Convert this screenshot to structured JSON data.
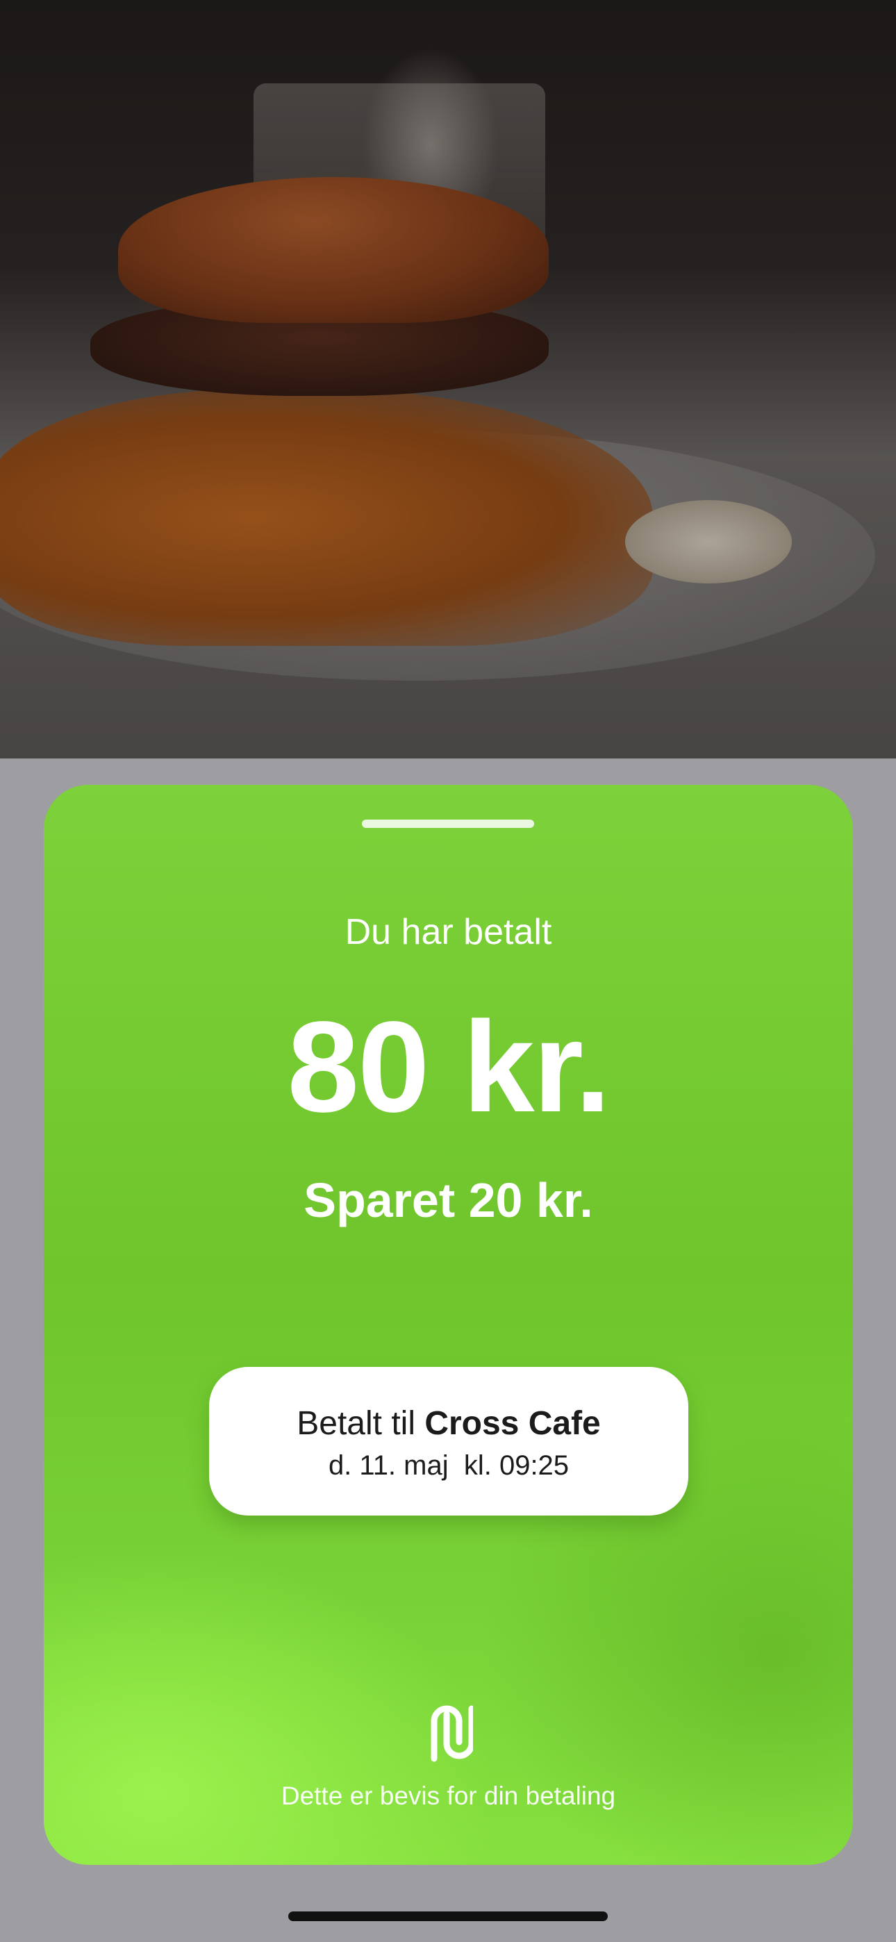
{
  "receipt": {
    "paid_label": "Du har betalt",
    "amount": "80 kr.",
    "saved": "Sparet 20 kr.",
    "merchant_prefix": "Betalt til ",
    "merchant_name": "Cross Cafe",
    "datetime": "d. 11. maj  kl. 09:25",
    "proof_text": "Dette er bevis for din betaling"
  },
  "colors": {
    "card_green": "#6fc52b",
    "card_green_light": "#86e03f",
    "pill_white": "#ffffff",
    "backdrop_gray": "#9e9da1"
  },
  "icons": {
    "brand_logo": "brand-logo-icon"
  }
}
